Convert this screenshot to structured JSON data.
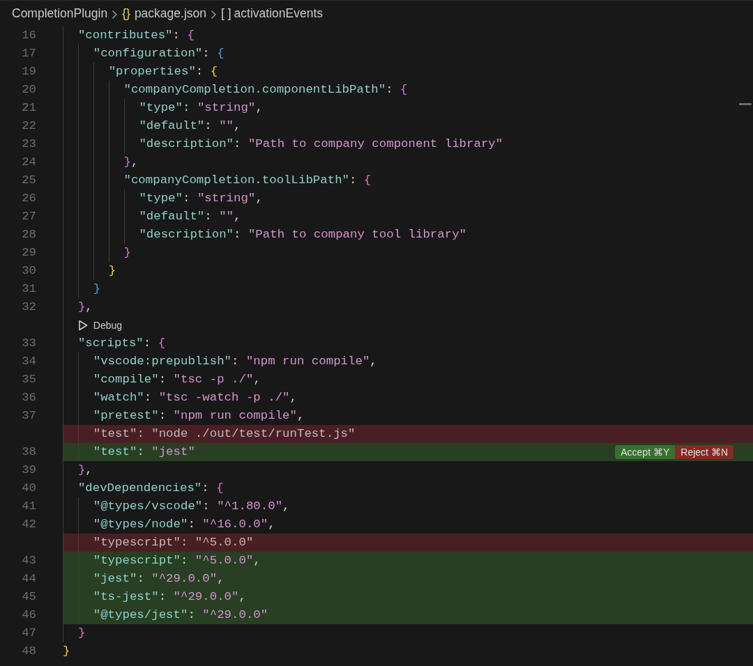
{
  "breadcrumb": [
    {
      "kind": "folder",
      "text": "CompletionPlugin"
    },
    {
      "kind": "file",
      "icon": "{}",
      "text": "package.json"
    },
    {
      "kind": "array",
      "icon": "[ ]",
      "text": "activationEvents"
    }
  ],
  "lines": [
    {
      "kind": "normal",
      "number": "16",
      "tokens": [
        {
          "kind": "key",
          "text": "  \"contributes\""
        },
        {
          "kind": "p",
          "text": ": "
        },
        {
          "kind": "b1",
          "text": "{"
        }
      ]
    },
    {
      "kind": "normal",
      "number": "17",
      "tokens": [
        {
          "kind": "key",
          "text": "    \"configuration\""
        },
        {
          "kind": "p",
          "text": ": "
        },
        {
          "kind": "b2",
          "text": "{"
        }
      ]
    },
    {
      "kind": "normal",
      "number": "19",
      "tokens": [
        {
          "kind": "key",
          "text": "      \"properties\""
        },
        {
          "kind": "p",
          "text": ": "
        },
        {
          "kind": "b3",
          "text": "{"
        }
      ]
    },
    {
      "kind": "normal",
      "number": "20",
      "tokens": [
        {
          "kind": "key",
          "text": "        \"companyCompletion.componentLibPath\""
        },
        {
          "kind": "p",
          "text": ": "
        },
        {
          "kind": "b1",
          "text": "{"
        }
      ]
    },
    {
      "kind": "normal",
      "number": "21",
      "tokens": [
        {
          "kind": "key",
          "text": "          \"type\""
        },
        {
          "kind": "p",
          "text": ": "
        },
        {
          "kind": "str",
          "text": "\"string\""
        },
        {
          "kind": "p",
          "text": ","
        }
      ]
    },
    {
      "kind": "normal",
      "number": "22",
      "tokens": [
        {
          "kind": "key",
          "text": "          \"default\""
        },
        {
          "kind": "p",
          "text": ": "
        },
        {
          "kind": "str",
          "text": "\"\""
        },
        {
          "kind": "p",
          "text": ","
        }
      ]
    },
    {
      "kind": "normal",
      "number": "23",
      "tokens": [
        {
          "kind": "key",
          "text": "          \"description\""
        },
        {
          "kind": "p",
          "text": ": "
        },
        {
          "kind": "str",
          "text": "\"Path to company component library\""
        }
      ]
    },
    {
      "kind": "normal",
      "number": "24",
      "tokens": [
        {
          "kind": "b1",
          "text": "        }"
        },
        {
          "kind": "p",
          "text": ","
        }
      ]
    },
    {
      "kind": "normal",
      "number": "25",
      "tokens": [
        {
          "kind": "key",
          "text": "        \"companyCompletion.toolLibPath\""
        },
        {
          "kind": "p",
          "text": ": "
        },
        {
          "kind": "b1",
          "text": "{"
        }
      ]
    },
    {
      "kind": "normal",
      "number": "26",
      "tokens": [
        {
          "kind": "key",
          "text": "          \"type\""
        },
        {
          "kind": "p",
          "text": ": "
        },
        {
          "kind": "str",
          "text": "\"string\""
        },
        {
          "kind": "p",
          "text": ","
        }
      ]
    },
    {
      "kind": "normal",
      "number": "27",
      "tokens": [
        {
          "kind": "key",
          "text": "          \"default\""
        },
        {
          "kind": "p",
          "text": ": "
        },
        {
          "kind": "str",
          "text": "\"\""
        },
        {
          "kind": "p",
          "text": ","
        }
      ]
    },
    {
      "kind": "normal",
      "number": "28",
      "tokens": [
        {
          "kind": "key",
          "text": "          \"description\""
        },
        {
          "kind": "p",
          "text": ": "
        },
        {
          "kind": "str",
          "text": "\"Path to company tool library\""
        }
      ]
    },
    {
      "kind": "normal",
      "number": "29",
      "tokens": [
        {
          "kind": "b1",
          "text": "        }"
        }
      ]
    },
    {
      "kind": "normal",
      "number": "30",
      "tokens": [
        {
          "kind": "b3",
          "text": "      }"
        }
      ]
    },
    {
      "kind": "normal",
      "number": "31",
      "tokens": [
        {
          "kind": "b2",
          "text": "    }"
        }
      ]
    },
    {
      "kind": "normal",
      "number": "32",
      "tokens": [
        {
          "kind": "b1",
          "text": "  }"
        },
        {
          "kind": "p",
          "text": ","
        }
      ]
    },
    {
      "kind": "codelens",
      "label": "Debug"
    },
    {
      "kind": "normal",
      "number": "33",
      "tokens": [
        {
          "kind": "key",
          "text": "  \"scripts\""
        },
        {
          "kind": "p",
          "text": ": "
        },
        {
          "kind": "b1",
          "text": "{"
        }
      ]
    },
    {
      "kind": "normal",
      "number": "34",
      "tokens": [
        {
          "kind": "key",
          "text": "    \"vscode:prepublish\""
        },
        {
          "kind": "p",
          "text": ": "
        },
        {
          "kind": "str",
          "text": "\"npm run compile\""
        },
        {
          "kind": "p",
          "text": ","
        }
      ]
    },
    {
      "kind": "normal",
      "number": "35",
      "tokens": [
        {
          "kind": "key",
          "text": "    \"compile\""
        },
        {
          "kind": "p",
          "text": ": "
        },
        {
          "kind": "str",
          "text": "\"tsc -p ./\""
        },
        {
          "kind": "p",
          "text": ","
        }
      ]
    },
    {
      "kind": "normal",
      "number": "36",
      "tokens": [
        {
          "kind": "key",
          "text": "    \"watch\""
        },
        {
          "kind": "p",
          "text": ": "
        },
        {
          "kind": "str",
          "text": "\"tsc -watch -p ./\""
        },
        {
          "kind": "p",
          "text": ","
        }
      ]
    },
    {
      "kind": "normal",
      "number": "37",
      "tokens": [
        {
          "kind": "key",
          "text": "    \"pretest\""
        },
        {
          "kind": "p",
          "text": ": "
        },
        {
          "kind": "str",
          "text": "\"npm run compile\""
        },
        {
          "kind": "p",
          "text": ","
        }
      ]
    },
    {
      "kind": "removed",
      "tokens": [
        {
          "kind": "key",
          "text": "    \"test\""
        },
        {
          "kind": "p",
          "text": ": "
        },
        {
          "kind": "str",
          "text": "\"node ./out/test/runTest.js\""
        }
      ]
    },
    {
      "kind": "added",
      "number": "38",
      "tokens": [
        {
          "kind": "key",
          "text": "    \"test\""
        },
        {
          "kind": "p",
          "text": ": "
        },
        {
          "kind": "str",
          "text": "\"jest\""
        }
      ],
      "actions": [
        {
          "kind": "accept",
          "label": "Accept ⌘Y"
        },
        {
          "kind": "reject",
          "label": "Reject ⌘N"
        }
      ]
    },
    {
      "kind": "normal",
      "number": "39",
      "tokens": [
        {
          "kind": "b1",
          "text": "  }"
        },
        {
          "kind": "p",
          "text": ","
        }
      ]
    },
    {
      "kind": "normal",
      "number": "40",
      "tokens": [
        {
          "kind": "key",
          "text": "  \"devDependencies\""
        },
        {
          "kind": "p",
          "text": ": "
        },
        {
          "kind": "b1",
          "text": "{"
        }
      ]
    },
    {
      "kind": "normal",
      "number": "41",
      "tokens": [
        {
          "kind": "key",
          "text": "    \"@types/vscode\""
        },
        {
          "kind": "p",
          "text": ": "
        },
        {
          "kind": "str",
          "text": "\"^1.80.0\""
        },
        {
          "kind": "p",
          "text": ","
        }
      ]
    },
    {
      "kind": "normal",
      "number": "42",
      "tokens": [
        {
          "kind": "key",
          "text": "    \"@types/node\""
        },
        {
          "kind": "p",
          "text": ": "
        },
        {
          "kind": "str",
          "text": "\"^16.0.0\""
        },
        {
          "kind": "p",
          "text": ","
        }
      ]
    },
    {
      "kind": "removed",
      "tokens": [
        {
          "kind": "key",
          "text": "    \"typescript\""
        },
        {
          "kind": "p",
          "text": ": "
        },
        {
          "kind": "str",
          "text": "\"^5.0.0\""
        }
      ]
    },
    {
      "kind": "added",
      "number": "43",
      "tokens": [
        {
          "kind": "key",
          "text": "    \"typescript\""
        },
        {
          "kind": "p",
          "text": ": "
        },
        {
          "kind": "str",
          "text": "\"^5.0.0\""
        },
        {
          "kind": "p",
          "text": ","
        }
      ]
    },
    {
      "kind": "added",
      "number": "44",
      "tokens": [
        {
          "kind": "key",
          "text": "    \"jest\""
        },
        {
          "kind": "p",
          "text": ": "
        },
        {
          "kind": "str",
          "text": "\"^29.0.0\""
        },
        {
          "kind": "p",
          "text": ","
        }
      ]
    },
    {
      "kind": "added",
      "number": "45",
      "tokens": [
        {
          "kind": "key",
          "text": "    \"ts-jest\""
        },
        {
          "kind": "p",
          "text": ": "
        },
        {
          "kind": "str",
          "text": "\"^29.0.0\""
        },
        {
          "kind": "p",
          "text": ","
        }
      ]
    },
    {
      "kind": "added",
      "number": "46",
      "tokens": [
        {
          "kind": "key",
          "text": "    \"@types/jest\""
        },
        {
          "kind": "p",
          "text": ": "
        },
        {
          "kind": "str",
          "text": "\"^29.0.0\""
        }
      ]
    },
    {
      "kind": "normal",
      "number": "47",
      "tokens": [
        {
          "kind": "b1",
          "text": "  }"
        }
      ]
    },
    {
      "kind": "normal",
      "number": "48",
      "tokens": [
        {
          "kind": "b3",
          "text": "}"
        }
      ]
    }
  ]
}
